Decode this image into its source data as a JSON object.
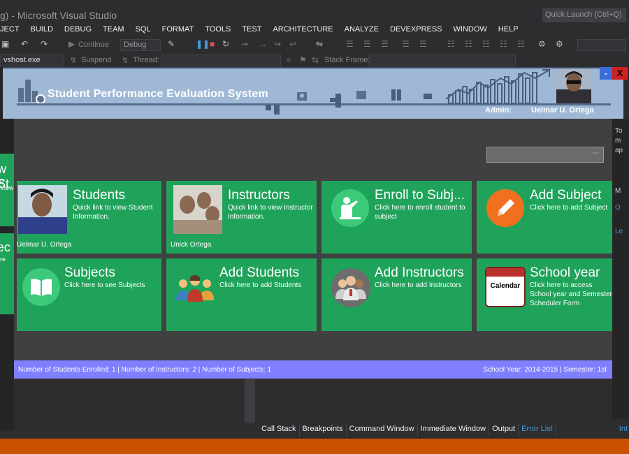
{
  "vs": {
    "title": "g) - Microsoft Visual Studio",
    "quick_launch": "Quick Launch (Ctrl+Q)",
    "menu": [
      "JECT",
      "BUILD",
      "DEBUG",
      "TEAM",
      "SQL",
      "FORMAT",
      "TOOLS",
      "TEST",
      "ARCHITECTURE",
      "ANALYZE",
      "DEVEXPRESS",
      "WINDOW",
      "HELP"
    ],
    "toolbar": {
      "continue": "Continue",
      "config": "Debug",
      "process": "vshost.exe",
      "suspend": "Suspend",
      "thread": "Thread:",
      "stack_frame": "Stack Frame:"
    },
    "left_tiles": [
      {
        "big": "w St",
        "small": "o View"
      },
      {
        "big": "ec",
        "small": "re"
      }
    ],
    "right_panel": [
      "To",
      "m",
      "ap",
      "M",
      "O",
      "Le"
    ],
    "bottom_tabs": [
      "Call Stack",
      "Breakpoints",
      "Command Window",
      "Immediate Window",
      "Output",
      "Error List"
    ],
    "bottom_tab_right": "Int"
  },
  "app": {
    "title": "Student Performance Evaluation System",
    "admin_label": "Admin:",
    "admin_name": "Uelmar U. Ortega",
    "minimize": "-",
    "close": "X",
    "tiles": [
      {
        "title": "Students",
        "subtitle": "Quick link to view Student Information.",
        "name": "Uelmar U. Ortega"
      },
      {
        "title": "Instructors",
        "subtitle": "Quick link to view Instructor Information.",
        "name": "Unick Ortega"
      },
      {
        "title": "Enroll to Subj...",
        "subtitle": "Click here to enroll student to subject"
      },
      {
        "title": "Add Subject",
        "subtitle": "Click here to add Subject"
      },
      {
        "title": "Subjects",
        "subtitle": "Click here to see Subjects"
      },
      {
        "title": "Add Students",
        "subtitle": "Click here to add Students"
      },
      {
        "title": "Add Instructors",
        "subtitle": "Click here to add Instructors"
      },
      {
        "title": "School year",
        "subtitle": "Click here to access School year and Semester Scheduler Form",
        "icon_text": "Calendar"
      }
    ],
    "status_left": "Number of Students Enrolled: 1  |  Number of Instructors: 2  |  Number of Subjects: 1",
    "status_right": "School Year: 2014-2015  |  Semester: 1st"
  },
  "colors": {
    "tile_green": "#1fa35a",
    "header_blue": "#9fb8d6",
    "status_purple": "#7f7fff",
    "vs_dark": "#2d2d30",
    "vs_orange": "#ca5100",
    "add_subject_orange": "#f07020"
  }
}
